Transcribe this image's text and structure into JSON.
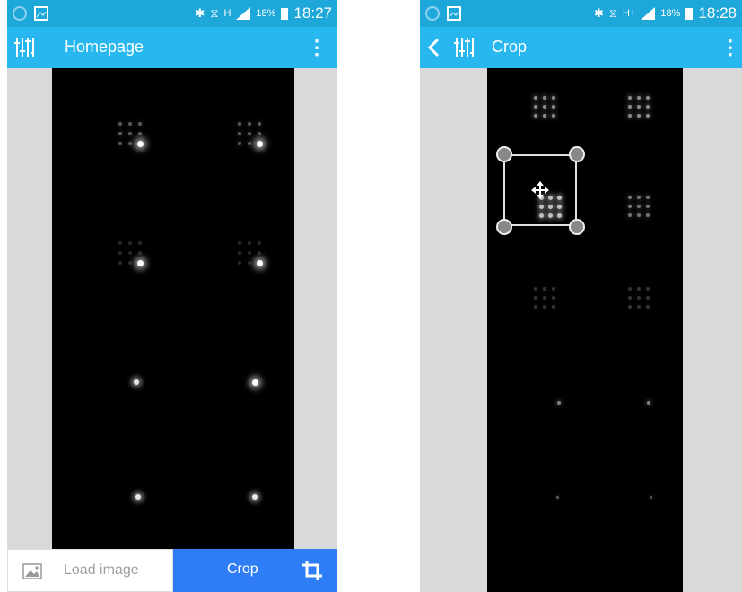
{
  "screens": [
    {
      "status": {
        "time": "18:27",
        "battery": "18%",
        "network": "H"
      },
      "toolbar": {
        "title": "Homepage",
        "menu_icon": "more-vert-icon",
        "app_icon": "equalizer-icon"
      },
      "bottom": {
        "load_label": "Load image",
        "crop_label": "Crop",
        "load_icon": "image-icon",
        "crop_icon": "crop-icon"
      }
    },
    {
      "status": {
        "time": "18:28",
        "battery": "18%",
        "network": "H+"
      },
      "toolbar": {
        "title": "Crop",
        "back_icon": "back-arrow-icon",
        "menu_icon": "more-vert-icon",
        "app_icon": "equalizer-icon"
      },
      "crop_box": {
        "handle_icon": "move-icon"
      }
    }
  ],
  "colors": {
    "statusbar": "#1EA8DA",
    "toolbar": "#28B7EE",
    "crop_button": "#2E7DF6",
    "viewer_bg": "#D9D9D9"
  }
}
